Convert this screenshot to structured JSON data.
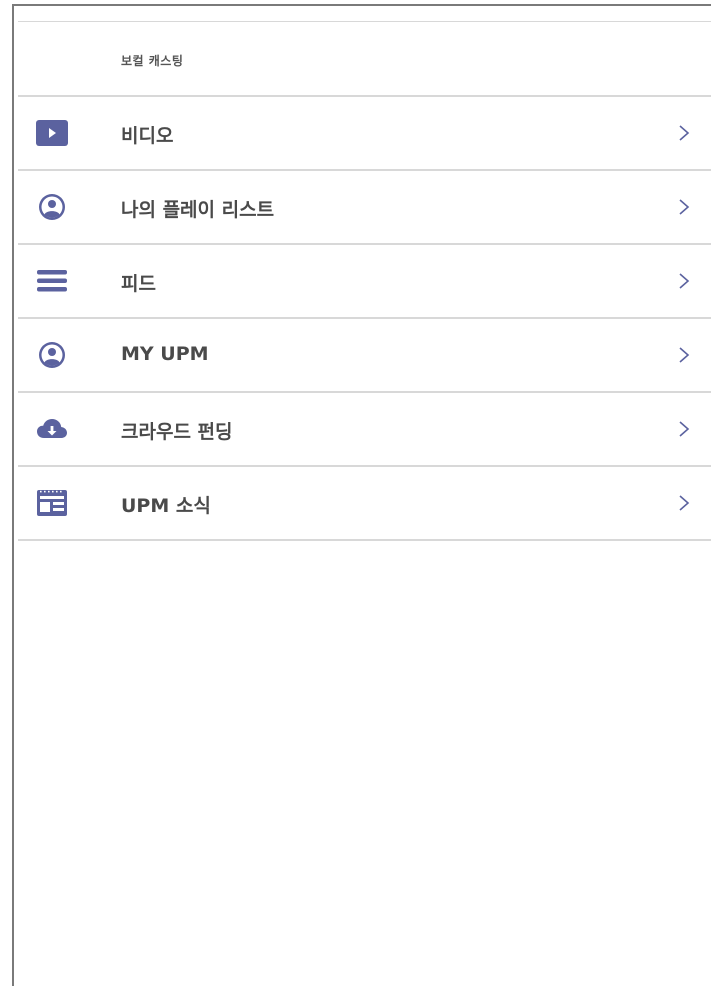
{
  "header": {
    "title": "보컬 캐스팅"
  },
  "menu": {
    "items": [
      {
        "label": "비디오",
        "icon": "play-icon"
      },
      {
        "label": "나의 플레이 리스트",
        "icon": "user-circle-icon"
      },
      {
        "label": "피드",
        "icon": "menu-icon"
      },
      {
        "label": "MY UPM",
        "icon": "user-circle-icon"
      },
      {
        "label": "크라우드 펀딩",
        "icon": "cloud-download-icon"
      },
      {
        "label": "UPM 소식",
        "icon": "news-icon"
      }
    ]
  },
  "colors": {
    "icon": "#5b629f",
    "text": "#4a4a4a",
    "chevron": "#5b629f",
    "divider": "#d8d8d8",
    "frame": "#7a7a7a"
  }
}
